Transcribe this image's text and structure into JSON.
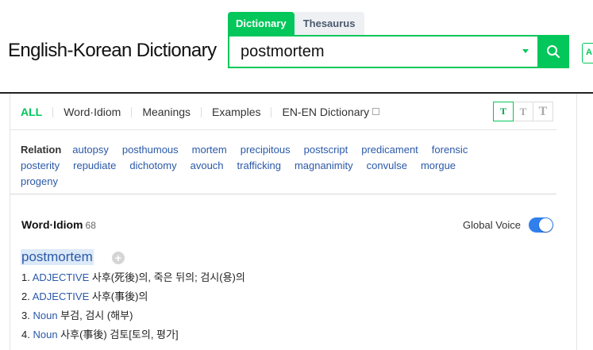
{
  "header": {
    "site_title": "English-Korean Dictionary",
    "tabs": [
      {
        "label": "Dictionary",
        "active": true
      },
      {
        "label": "Thesaurus",
        "active": false
      }
    ],
    "search": {
      "value": "postmortem"
    },
    "side_button": "A"
  },
  "nav": {
    "tabs": [
      "ALL",
      "Word·Idiom",
      "Meanings",
      "Examples",
      "EN-EN Dictionary"
    ],
    "active": "ALL",
    "font_sizes": [
      "T",
      "T",
      "T"
    ]
  },
  "relation": {
    "label": "Relation",
    "words": [
      "autopsy",
      "posthumous",
      "mortem",
      "precipitous",
      "postscript",
      "predicament",
      "forensic",
      "posterity",
      "repudiate",
      "dichotomy",
      "avouch",
      "trafficking",
      "magnanimity",
      "convulse",
      "morgue",
      "progeny"
    ]
  },
  "word_idiom": {
    "title": "Word·Idiom",
    "count": "68",
    "global_voice_label": "Global Voice",
    "global_voice_on": true,
    "entry": {
      "word": "postmortem",
      "meanings": [
        {
          "num": "1.",
          "pos": "ADJECTIVE",
          "text": "사후(死後)의, 죽은 뒤의; 검시(용)의"
        },
        {
          "num": "2.",
          "pos": "ADJECTIVE",
          "text": "사후(事後)의"
        },
        {
          "num": "3.",
          "pos": "Noun",
          "text": "부검, 검시 (해부)"
        },
        {
          "num": "4.",
          "pos": "Noun",
          "text": "사후(事後) 검토[토의, 평가]"
        }
      ]
    }
  },
  "colors": {
    "accent": "#03c75a",
    "link": "#2b59a8",
    "toggle": "#2f80ed"
  }
}
